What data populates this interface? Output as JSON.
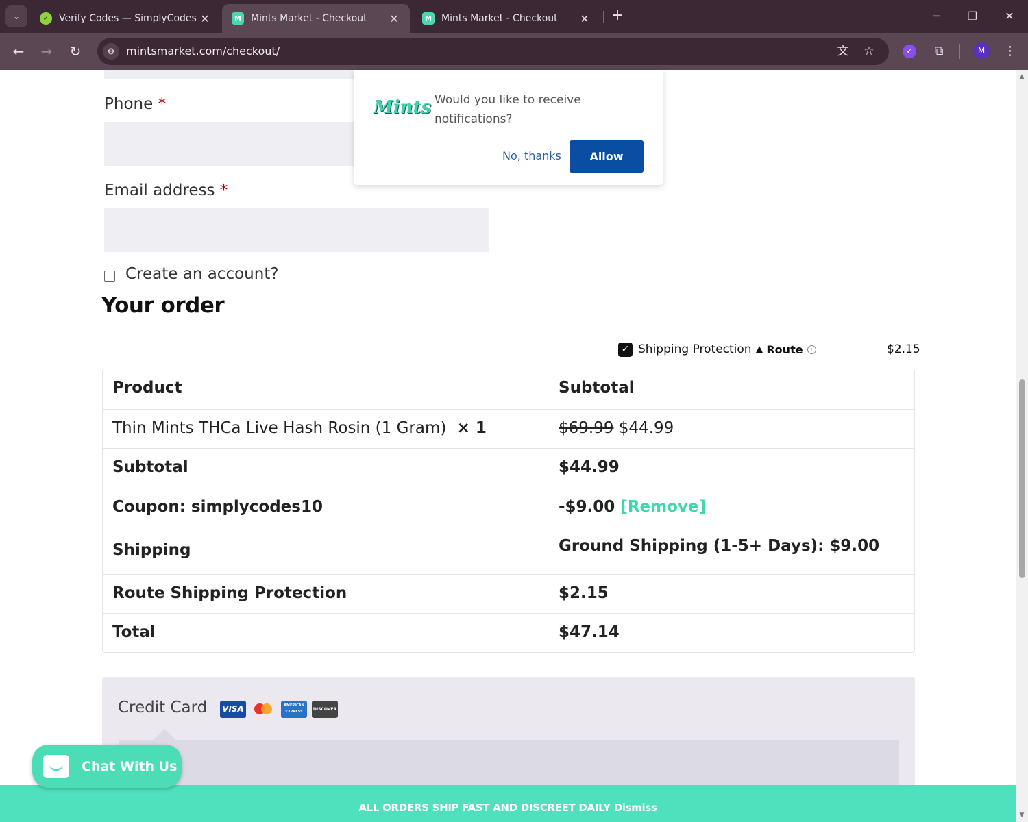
{
  "browser": {
    "tabs": [
      {
        "title": "Verify Codes — SimplyCodes",
        "active": false
      },
      {
        "title": "Mints Market - Checkout",
        "active": true
      },
      {
        "title": "Mints Market - Checkout",
        "active": false
      }
    ],
    "url": "mintsmarket.com/checkout/",
    "profile_initial": "M"
  },
  "form": {
    "phone_label": "Phone",
    "email_label": "Email address",
    "required_mark": "*",
    "create_account_label": "Create an account?"
  },
  "order": {
    "heading": "Your order",
    "shipping_protection": {
      "label": "Shipping Protection",
      "brand": "Route",
      "price": "$2.15",
      "checked": true
    },
    "table": {
      "headers": [
        "Product",
        "Subtotal"
      ],
      "item": {
        "name": "Thin Mints THCa Live Hash Rosin (1 Gram)",
        "qty": "× 1",
        "old_price": "$69.99",
        "price": "$44.99"
      },
      "subtotal": {
        "label": "Subtotal",
        "value": "$44.99"
      },
      "coupon": {
        "label": "Coupon: simplycodes10",
        "value": "-$9.00",
        "remove": "[Remove]"
      },
      "shipping": {
        "label": "Shipping",
        "value": "Ground Shipping (1-5+ Days): $9.00"
      },
      "route": {
        "label": "Route Shipping Protection",
        "value": "$2.15"
      },
      "total": {
        "label": "Total",
        "value": "$47.14"
      }
    }
  },
  "payment": {
    "method_label": "Credit Card",
    "cards": [
      "VISA",
      "Mastercard",
      "AMERICAN EXPRESS",
      "DISCOVER"
    ]
  },
  "chat": {
    "label": "Chat With Us"
  },
  "banner": {
    "text": "ALL ORDERS SHIP FAST AND DISCREET DAILY",
    "dismiss": "Dismiss"
  },
  "notification_prompt": {
    "logo": "Mints",
    "message": "Would you like to receive notifications?",
    "decline": "No, thanks",
    "accept": "Allow"
  },
  "colors": {
    "accent": "#4cdcb6",
    "allow_button": "#0a4ea3",
    "chrome": "#3b2834"
  }
}
